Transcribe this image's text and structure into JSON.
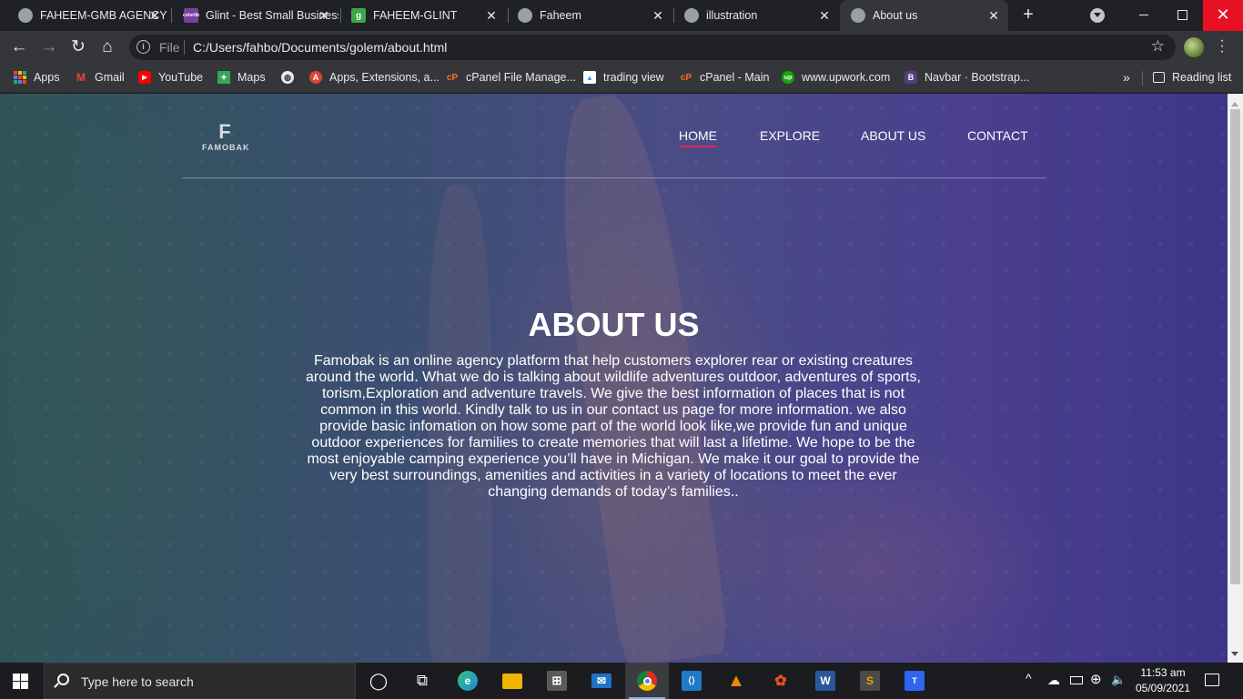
{
  "browser": {
    "tabs": [
      {
        "title": "FAHEEM-GMB AGENCY",
        "icon": "globe-icon",
        "color": "#9aa0a6"
      },
      {
        "title": "Glint - Best Small Business",
        "icon": "colorlib-icon",
        "color": "#7b3fa0",
        "glyph": "colorlib"
      },
      {
        "title": "FAHEEM-GLINT",
        "icon": "g-icon",
        "color": "#3aa84a",
        "glyph": "g"
      },
      {
        "title": "Faheem",
        "icon": "globe-icon",
        "color": "#9aa0a6"
      },
      {
        "title": "illustration",
        "icon": "globe-icon",
        "color": "#9aa0a6"
      },
      {
        "title": "About us",
        "icon": "globe-icon",
        "color": "#9aa0a6"
      }
    ],
    "address": {
      "scheme_label": "File",
      "url": "C:/Users/fahbo/Documents/golem/about.html"
    },
    "bookmarks": [
      {
        "label": "Apps",
        "icon": "apps-grid-icon"
      },
      {
        "label": "Gmail",
        "icon": "gmail-icon",
        "color": "#ea4335",
        "glyph": "M"
      },
      {
        "label": "YouTube",
        "icon": "youtube-icon",
        "color": "#ff0000",
        "glyph": "▶"
      },
      {
        "label": "Maps",
        "icon": "maps-icon",
        "color": "#34a853",
        "glyph": "✦"
      },
      {
        "label": "",
        "icon": "globe-icon",
        "color": "#e8eaed"
      },
      {
        "label": "Apps, Extensions, a...",
        "icon": "webstore-icon",
        "color": "#db4437",
        "glyph": "A"
      },
      {
        "label": "cPanel File Manage...",
        "icon": "cpanel-icon",
        "color": "#ff6c2c",
        "glyph": "cP"
      },
      {
        "label": "trading view",
        "icon": "image-icon",
        "color": "#4a90d9",
        "glyph": "▲"
      },
      {
        "label": "cPanel - Main",
        "icon": "cpanel-icon",
        "color": "#ff6c2c",
        "glyph": "cP"
      },
      {
        "label": "www.upwork.com",
        "icon": "upwork-icon",
        "color": "#14a800",
        "glyph": "up"
      },
      {
        "label": "Navbar · Bootstrap...",
        "icon": "bootstrap-icon",
        "color": "#563d7c",
        "glyph": "B"
      }
    ],
    "reading_list": "Reading list",
    "more_bookmarks": "»"
  },
  "site": {
    "logo": {
      "mark": "F",
      "text": "FAMOBAK"
    },
    "nav": [
      "HOME",
      "EXPLORE",
      "ABOUT US",
      "CONTACT"
    ],
    "active_nav": "HOME",
    "accent": "#e0245e",
    "title": "ABOUT US",
    "body": "Famobak is an online agency platform that help customers explorer rear or existing creatures around the world. What we do is talking about wildlife adventures outdoor, adventures of sports, torism,Exploration and adventure travels. We give the best information of places that is not common in this world. Kindly talk to us in our contact us page for more information. we also provide basic infomation on how some part of the world look like,we provide fun and unique outdoor experiences for families to create memories that will last a lifetime. We hope to be the most enjoyable camping experience you’ll have in Michigan. We make it our goal to provide the very best surroundings, amenities and activities in a variety of locations to meet the ever changing demands of today’s families.."
  },
  "taskbar": {
    "search_placeholder": "Type here to search",
    "apps": [
      {
        "name": "cortana-icon",
        "glyph": "◯",
        "color": "transparent"
      },
      {
        "name": "task-view-icon",
        "glyph": "⧉",
        "color": "transparent"
      },
      {
        "name": "edge-icon",
        "glyph": "e",
        "color": "#1c8ad6"
      },
      {
        "name": "file-explorer-icon",
        "glyph": "▬",
        "color": "#f0b400"
      },
      {
        "name": "store-icon",
        "glyph": "⊞",
        "color": "#5a5a5a"
      },
      {
        "name": "mail-icon",
        "glyph": "✉",
        "color": "#1e73c8"
      },
      {
        "name": "chrome-icon",
        "glyph": "◉",
        "color": "#d93025",
        "active": true
      },
      {
        "name": "vscode-icon",
        "glyph": "⟨⟩",
        "color": "#1f7ac8"
      },
      {
        "name": "vlc-icon",
        "glyph": "▲",
        "color": "#f08a00"
      },
      {
        "name": "figma-icon",
        "glyph": "✿",
        "color": "#a259ff"
      },
      {
        "name": "word-icon",
        "glyph": "W",
        "color": "#2b579a"
      },
      {
        "name": "sublime-icon",
        "glyph": "S",
        "color": "#ff9800"
      },
      {
        "name": "typora-icon",
        "glyph": "T",
        "color": "#2f64f0"
      }
    ],
    "tray_up": "^",
    "time": "11:53 am",
    "date": "05/09/2021"
  }
}
